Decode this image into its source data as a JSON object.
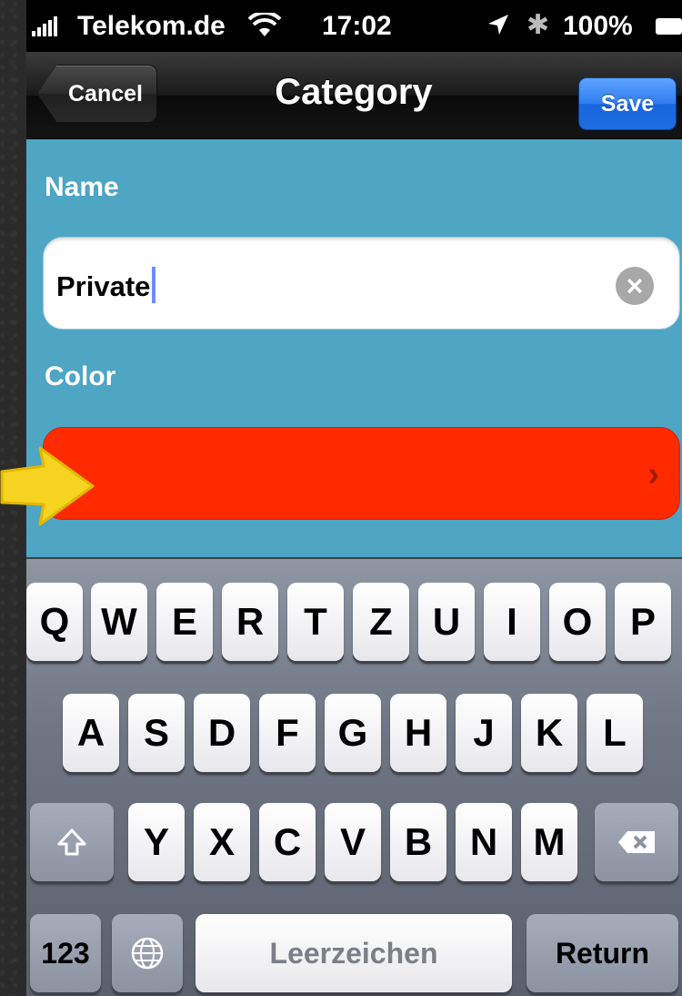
{
  "status_bar": {
    "carrier": "Telekom.de",
    "time": "17:02",
    "battery": "100%"
  },
  "nav": {
    "cancel_label": "Cancel",
    "title": "Category",
    "save_label": "Save"
  },
  "form": {
    "name_label": "Name",
    "name_value": "Private",
    "color_label": "Color",
    "color_value": "#ff2a00"
  },
  "keyboard": {
    "row1": [
      "Q",
      "W",
      "E",
      "R",
      "T",
      "Z",
      "U",
      "I",
      "O",
      "P"
    ],
    "row2": [
      "A",
      "S",
      "D",
      "F",
      "G",
      "H",
      "J",
      "K",
      "L"
    ],
    "row3": [
      "Y",
      "X",
      "C",
      "V",
      "B",
      "N",
      "M"
    ],
    "numbers_label": "123",
    "space_label": "Leerzeichen",
    "return_label": "Return"
  },
  "colors": {
    "content_bg": "#4ea5c4",
    "save_button": "#2f7ef0",
    "annotation_arrow": "#f5d320"
  }
}
